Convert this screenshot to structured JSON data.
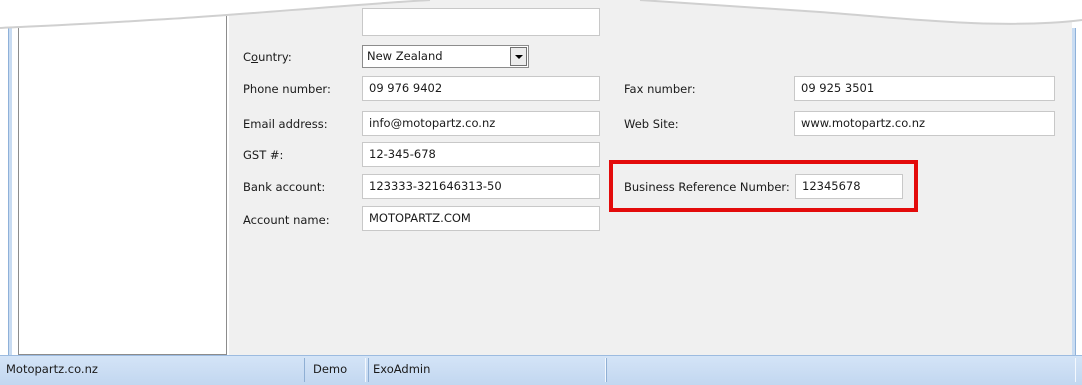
{
  "form": {
    "country_label_pre": "C",
    "country_label_u": "o",
    "country_label_post": "untry:",
    "country_value": "New Zealand",
    "phone_label": "Phone number:",
    "phone_value": "09 976 9402",
    "fax_label": "Fax number:",
    "fax_value": "09 925 3501",
    "email_label": "Email address:",
    "email_value": "info@motopartz.co.nz",
    "website_label": "Web Site:",
    "website_value": "www.motopartz.co.nz",
    "gst_label": "GST #:",
    "gst_value": "12-345-678",
    "bank_label": "Bank account:",
    "bank_value": "123333-321646313-50",
    "brn_label": "Business Reference Number:",
    "brn_value": "12345678",
    "account_name_label": "Account name:",
    "account_name_value": "MOTOPARTZ.COM"
  },
  "statusbar": {
    "company": "Motopartz.co.nz",
    "database": "Demo",
    "user": "ExoAdmin"
  },
  "colors": {
    "highlight": "#e30b0b",
    "statusbar": "#c9dcf2",
    "panel": "#f0f0f0"
  },
  "icons": {
    "combo_arrow": "chevron-down-icon"
  }
}
